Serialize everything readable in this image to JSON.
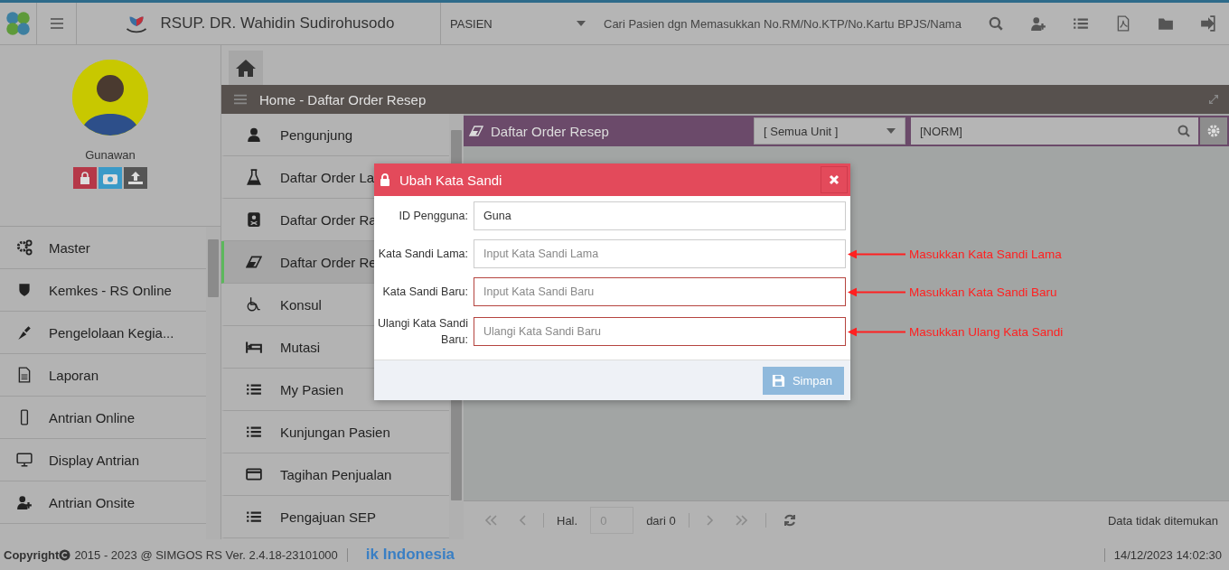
{
  "topbar": {
    "hospital": "RSUP. DR. Wahidin Sudirohusodo",
    "category": "PASIEN",
    "search_placeholder": "Cari Pasien dgn Memasukkan No.RM/No.KTP/No.Kartu BPJS/Nama"
  },
  "profile": {
    "name": "Gunawan"
  },
  "sidebar": {
    "items": [
      {
        "label": "Master"
      },
      {
        "label": "Kemkes - RS Online"
      },
      {
        "label": "Pengelolaan Kegia..."
      },
      {
        "label": "Laporan"
      },
      {
        "label": "Antrian Online"
      },
      {
        "label": "Display Antrian"
      },
      {
        "label": "Antrian Onsite"
      }
    ]
  },
  "breadcrumb": "Home - Daftar Order Resep",
  "submenu": {
    "items": [
      {
        "label": "Pengunjung",
        "selected": false
      },
      {
        "label": "Daftar Order La",
        "selected": false
      },
      {
        "label": "Daftar Order Ra",
        "selected": false
      },
      {
        "label": "Daftar Order Re",
        "selected": true
      },
      {
        "label": "Konsul",
        "selected": false
      },
      {
        "label": "Mutasi",
        "selected": false
      },
      {
        "label": "My Pasien",
        "selected": false
      },
      {
        "label": "Kunjungan Pasien",
        "selected": false
      },
      {
        "label": "Tagihan Penjualan",
        "selected": false
      },
      {
        "label": "Pengajuan SEP",
        "selected": false
      }
    ]
  },
  "panel": {
    "title": "Daftar Order Resep",
    "unit_select": "[ Semua Unit ]",
    "search_value": "[NORM]"
  },
  "pager": {
    "page_label": "Hal.",
    "page_value": "0",
    "of_label": "dari 0",
    "status": "Data tidak ditemukan"
  },
  "footer": {
    "copyright_label": "Copyright",
    "copyright": "2015 - 2023 @ SIMGOS RS Ver. 2.4.18-23101000",
    "brand": "ik Indonesia",
    "datetime": "14/12/2023 14:02:30"
  },
  "dialog": {
    "title": "Ubah Kata Sandi",
    "fields": [
      {
        "label": "ID Pengguna:",
        "value": "Guna",
        "invalid": false
      },
      {
        "label": "Kata Sandi Lama:",
        "placeholder": "Input Kata Sandi Lama",
        "invalid": false,
        "annotation": "Masukkan Kata Sandi Lama"
      },
      {
        "label": "Kata Sandi Baru:",
        "placeholder": "Input Kata Sandi Baru",
        "invalid": true,
        "annotation": "Masukkan Kata Sandi Baru"
      },
      {
        "label": "Ulangi Kata Sandi Baru:",
        "placeholder": "Ulangi Kata Sandi Baru",
        "invalid": true,
        "annotation": "Masukkan Ulang Kata Sandi"
      }
    ],
    "save_button": "Simpan"
  }
}
